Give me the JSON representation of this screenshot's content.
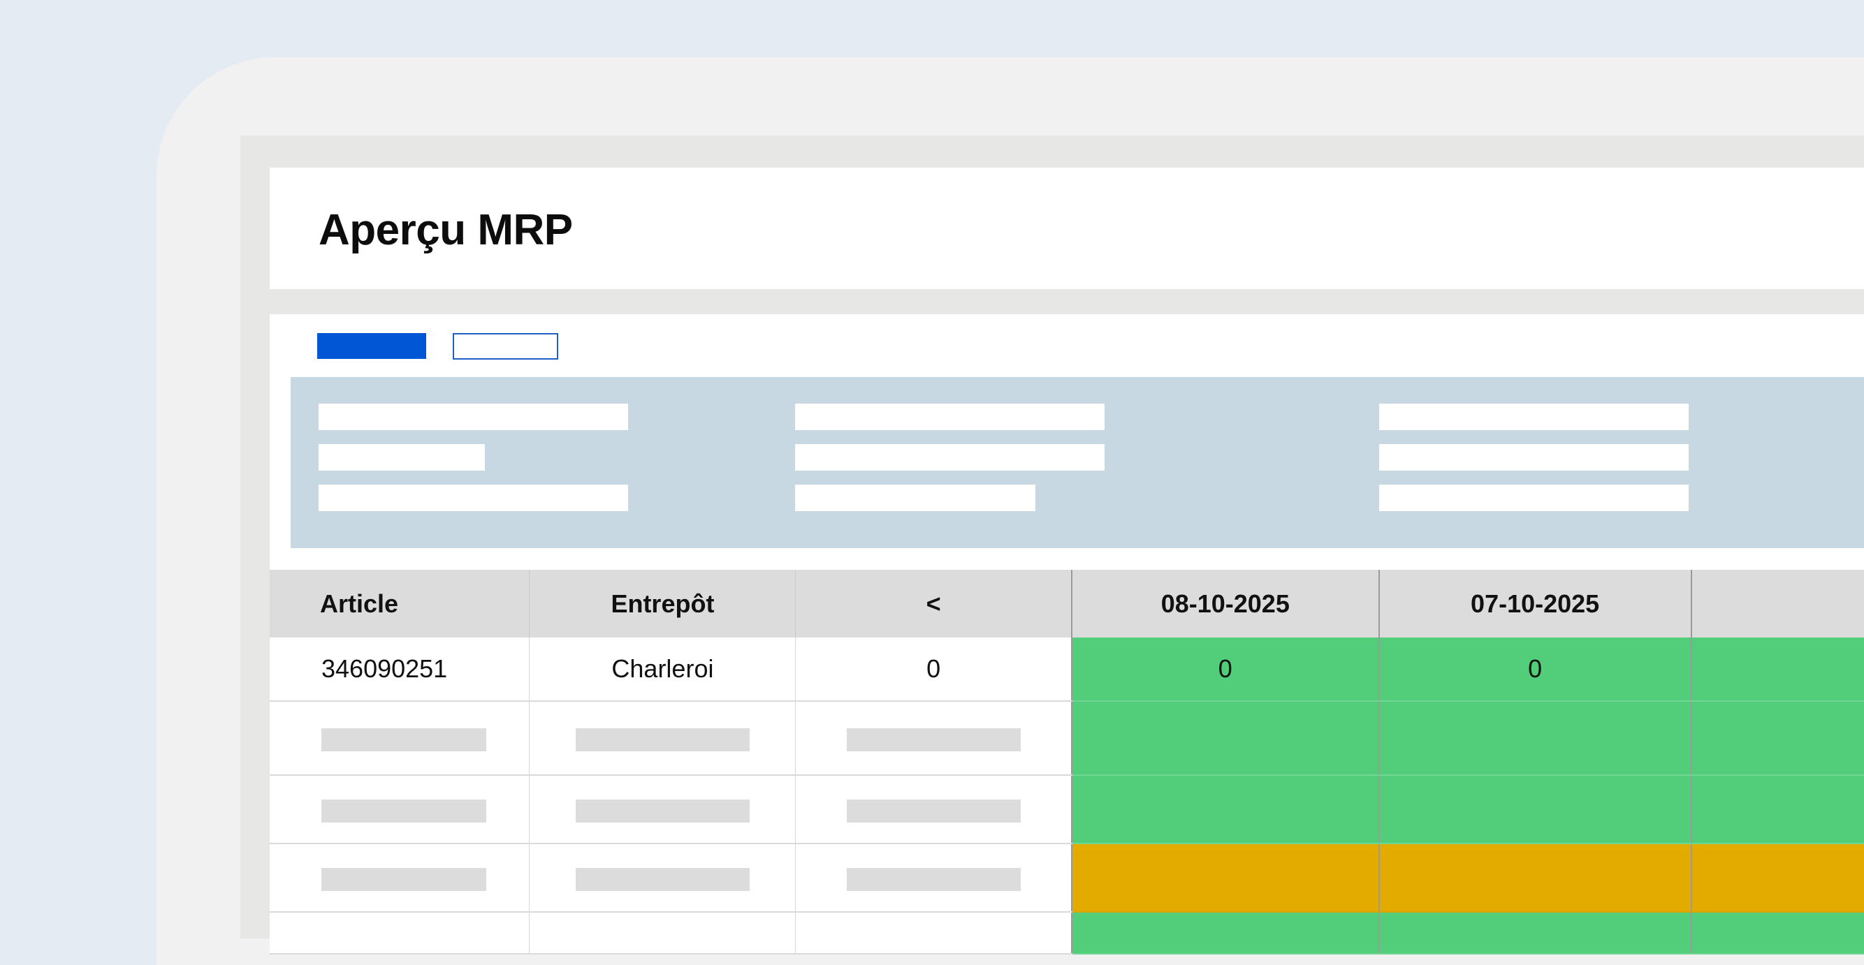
{
  "page": {
    "title": "Aperçu MRP"
  },
  "toolbar": {
    "primary_label": "",
    "secondary_label": ""
  },
  "table": {
    "headers": [
      "Article",
      "Entrepôt",
      "<",
      "08-10-2025",
      "07-10-2025",
      ""
    ],
    "rows": [
      {
        "article": "346090251",
        "warehouse": "Charleroi",
        "before": "0",
        "d1": "0",
        "d2": "0",
        "d3": ""
      }
    ],
    "row_status_colors": [
      "green",
      "green",
      "green",
      "amber",
      "green"
    ]
  },
  "colors": {
    "primary": "#0156d6",
    "status_ok": "#52cd7a",
    "status_warning": "#e3aa00",
    "filter_panel": "#c7d8e2"
  }
}
